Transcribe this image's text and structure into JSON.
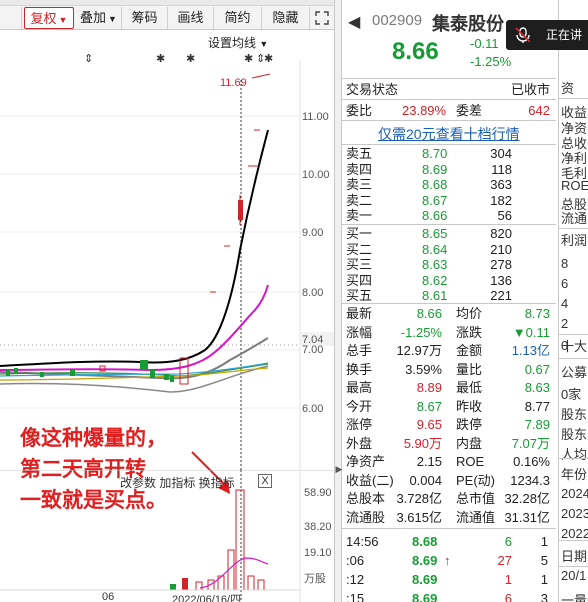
{
  "toolbar": {
    "buttons": [
      "复权",
      "叠加",
      "筹码",
      "画线",
      "简约",
      "隐藏"
    ],
    "expand_icon": "fullscreen-icon"
  },
  "chart": {
    "ma_setting": "设置均线",
    "high_marker": "11.69",
    "price_ticks": [
      "11.00",
      "10.00",
      "9.00",
      "8.00",
      "7.04",
      "7.00",
      "6.00"
    ],
    "annotation_line1": "像这种爆量的，",
    "annotation_line2": "第二天高开转",
    "annotation_line3": "一致就是买点。",
    "volume_header": "改参数  加指标  换指标",
    "volume_close": "X",
    "volume_ticks": [
      "58.90",
      "38.20",
      "19.10",
      "万股"
    ],
    "date_label": "2022/06/16/四",
    "date_label_left": "06"
  },
  "quote": {
    "back": "◀",
    "code": "002909",
    "name": "集泰股份",
    "price": "8.66",
    "change": "-0.11",
    "change_pct": "-1.25%",
    "trade_status_label": "交易状态",
    "trade_status": "已收市",
    "weibi_label": "委比",
    "weibi": "23.89%",
    "weicha_label": "委差",
    "weicha": "642",
    "orderbook_link": "仅需20元查看十档行情",
    "asks": [
      {
        "label": "卖五",
        "price": "8.70",
        "vol": "304"
      },
      {
        "label": "卖四",
        "price": "8.69",
        "vol": "118"
      },
      {
        "label": "卖三",
        "price": "8.68",
        "vol": "363"
      },
      {
        "label": "卖二",
        "price": "8.67",
        "vol": "182"
      },
      {
        "label": "卖一",
        "price": "8.66",
        "vol": "56"
      }
    ],
    "bids": [
      {
        "label": "买一",
        "price": "8.65",
        "vol": "820"
      },
      {
        "label": "买二",
        "price": "8.64",
        "vol": "210"
      },
      {
        "label": "买三",
        "price": "8.63",
        "vol": "278"
      },
      {
        "label": "买四",
        "price": "8.62",
        "vol": "136"
      },
      {
        "label": "买五",
        "price": "8.61",
        "vol": "221"
      }
    ],
    "stats": [
      {
        "l1": "最新",
        "v1": "8.66",
        "c1": "green",
        "l2": "均价",
        "v2": "8.73",
        "c2": "green"
      },
      {
        "l1": "涨幅",
        "v1": "-1.25%",
        "c1": "green",
        "l2": "涨跌",
        "v2": "▼0.11",
        "c2": "green"
      },
      {
        "l1": "总手",
        "v1": "12.97万",
        "c1": "black",
        "l2": "金额",
        "v2": "1.13亿",
        "c2": "blue"
      },
      {
        "l1": "换手",
        "v1": "3.59%",
        "c1": "black",
        "l2": "量比",
        "v2": "0.67",
        "c2": "green"
      },
      {
        "l1": "最高",
        "v1": "8.89",
        "c1": "red",
        "l2": "最低",
        "v2": "8.63",
        "c2": "green"
      },
      {
        "l1": "今开",
        "v1": "8.67",
        "c1": "green",
        "l2": "昨收",
        "v2": "8.77",
        "c2": "black"
      },
      {
        "l1": "涨停",
        "v1": "9.65",
        "c1": "red",
        "l2": "跌停",
        "v2": "7.89",
        "c2": "green"
      },
      {
        "l1": "外盘",
        "v1": "5.90万",
        "c1": "red",
        "l2": "内盘",
        "v2": "7.07万",
        "c2": "green"
      },
      {
        "l1": "净资产",
        "v1": "2.15",
        "c1": "black",
        "l2": "ROE",
        "v2": "0.16%",
        "c2": "black"
      },
      {
        "l1": "收益(二)",
        "v1": "0.004",
        "c1": "black",
        "l2": "PE(动)",
        "v2": "1234.3",
        "c2": "black"
      },
      {
        "l1": "总股本",
        "v1": "3.728亿",
        "c1": "black",
        "l2": "总市值",
        "v2": "32.28亿",
        "c2": "black"
      },
      {
        "l1": "流通股",
        "v1": "3.615亿",
        "c1": "black",
        "l2": "流通值",
        "v2": "31.31亿",
        "c2": "black"
      }
    ],
    "ticks": [
      {
        "time": "14:56",
        "price": "8.68",
        "arrow": "",
        "vol": "6",
        "n": "1",
        "vcolor": "green"
      },
      {
        "time": ":06",
        "price": "8.69",
        "arrow": "↑",
        "vol": "27",
        "n": "5",
        "vcolor": "red"
      },
      {
        "time": ":12",
        "price": "8.69",
        "arrow": "",
        "vol": "1",
        "n": "1",
        "vcolor": "red"
      },
      {
        "time": ":15",
        "price": "8.69",
        "arrow": "",
        "vol": "6",
        "n": "3",
        "vcolor": "red"
      }
    ]
  },
  "right_pane": {
    "items": [
      "资",
      "收益",
      "净资",
      "总收",
      "净利",
      "毛利",
      "ROE",
      "总股",
      "流通",
      "利润",
      "8",
      "6",
      "4",
      "2",
      "0",
      "十大",
      "公募",
      "0家",
      "股东",
      "股东",
      "人均",
      "年份",
      "2024",
      "2023",
      "2022",
      "日期",
      "20/1",
      "一量一"
    ]
  },
  "voice": {
    "text": "正在讲"
  },
  "colors": {
    "up": "#d2232a",
    "down": "#179c34",
    "link": "#1a5fb4"
  }
}
